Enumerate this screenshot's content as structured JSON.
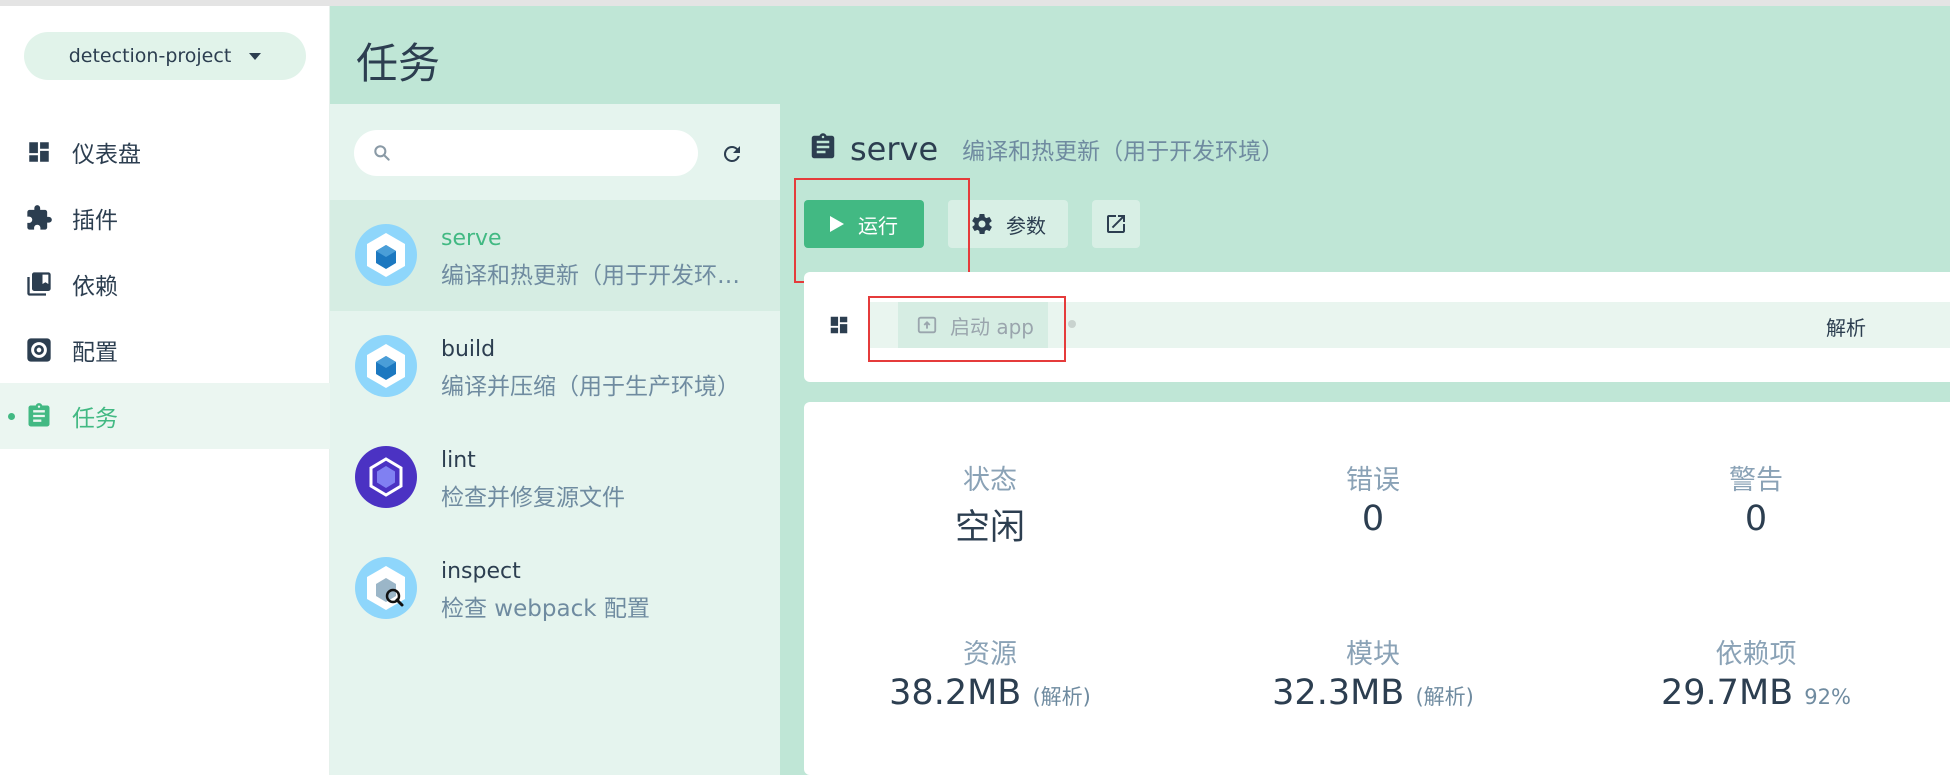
{
  "project": {
    "name": "detection-project"
  },
  "nav": [
    {
      "label": "仪表盘",
      "icon": "dashboard-icon"
    },
    {
      "label": "插件",
      "icon": "puzzle-icon"
    },
    {
      "label": "依赖",
      "icon": "library-icon"
    },
    {
      "label": "配置",
      "icon": "gear-icon"
    },
    {
      "label": "任务",
      "icon": "clipboard-icon",
      "active": true
    }
  ],
  "header": {
    "title": "任务"
  },
  "search": {
    "placeholder": "",
    "value": ""
  },
  "tasks": [
    {
      "name": "serve",
      "desc": "编译和热更新（用于开发环境）",
      "icon": "webpack-cube-icon",
      "selected": true
    },
    {
      "name": "build",
      "desc": "编译并压缩（用于生产环境）",
      "icon": "webpack-cube-icon"
    },
    {
      "name": "lint",
      "desc": "检查并修复源文件",
      "icon": "eslint-icon"
    },
    {
      "name": "inspect",
      "desc": "检查 webpack 配置",
      "icon": "webpack-inspect-icon"
    }
  ],
  "detail": {
    "name": "serve",
    "desc": "编译和热更新（用于开发环境）",
    "run_label": "运行",
    "params_label": "参数",
    "tabs": {
      "launch_label": "启动 app",
      "analyze_label": "解析"
    },
    "stats": {
      "status": {
        "label": "状态",
        "value": "空闲"
      },
      "errors": {
        "label": "错误",
        "value": "0"
      },
      "warnings": {
        "label": "警告",
        "value": "0"
      },
      "assets": {
        "label": "资源",
        "value": "38.2MB",
        "sub": "(解析)"
      },
      "modules": {
        "label": "模块",
        "value": "32.3MB",
        "sub": "(解析)"
      },
      "deps": {
        "label": "依赖项",
        "value": "29.7MB",
        "sub": "92%"
      }
    }
  },
  "colors": {
    "accent": "#42b983",
    "panel": "#bfe6d6",
    "highlight": "#e53b3b"
  }
}
